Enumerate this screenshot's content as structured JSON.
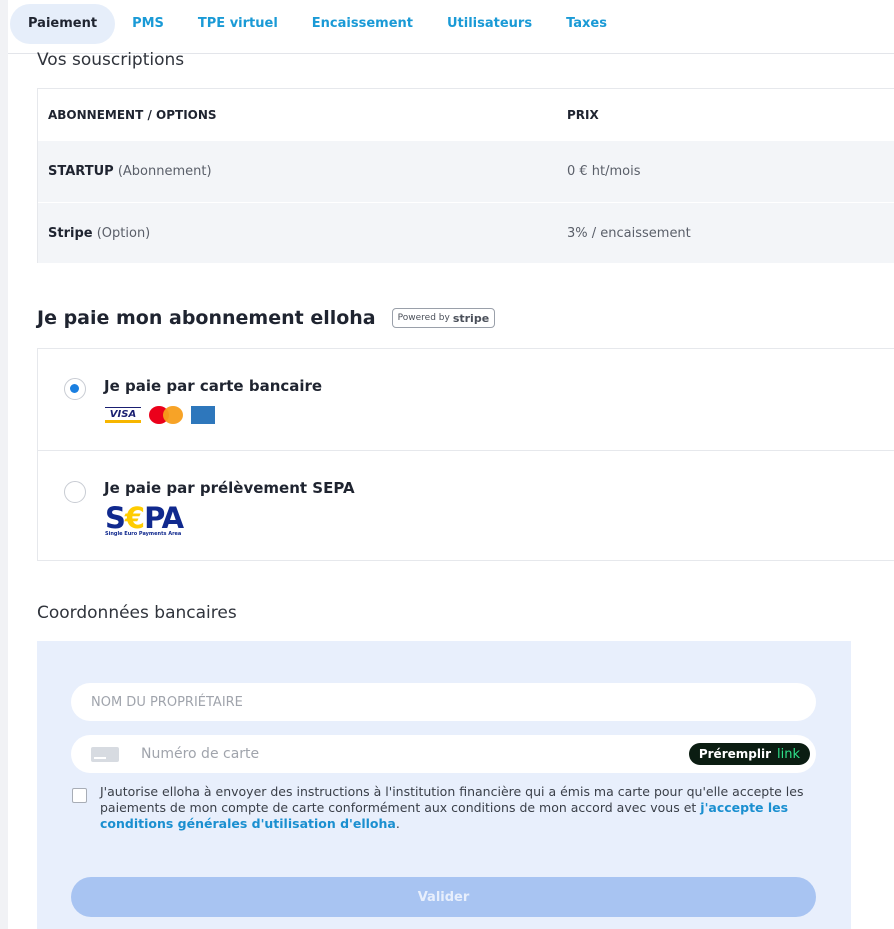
{
  "tabs": [
    {
      "label": "Paiement",
      "active": true
    },
    {
      "label": "PMS"
    },
    {
      "label": "TPE virtuel"
    },
    {
      "label": "Encaissement"
    },
    {
      "label": "Utilisateurs"
    },
    {
      "label": "Taxes"
    }
  ],
  "subscriptions": {
    "title": "Vos souscriptions",
    "headers": [
      "ABONNEMENT / OPTIONS",
      "PRIX"
    ],
    "rows": [
      {
        "name": "STARTUP",
        "type": "(Abonnement)",
        "price": "0 € ht/mois"
      },
      {
        "name": "Stripe",
        "type": "(Option)",
        "price": "3% / encaissement"
      }
    ]
  },
  "payment": {
    "title": "Je paie mon abonnement elloha",
    "badge_prefix": "Powered by",
    "badge_brand": "stripe",
    "options": [
      {
        "label": "Je paie par carte bancaire",
        "checked": true,
        "logos": [
          "VISA",
          "MasterCard",
          "American Express"
        ]
      },
      {
        "label": "Je paie par prélèvement SEPA",
        "checked": false,
        "logo_text": "S€PA",
        "logo_caption": "Single Euro Payments Area"
      }
    ]
  },
  "bank": {
    "title": "Coordonnées bancaires",
    "owner_placeholder": "NOM DU PROPRIÉTAIRE",
    "card_placeholder": "Numéro de carte",
    "prefill_label": "Préremplir",
    "prefill_brand": "link",
    "consent_text": "J'autorise elloha à envoyer des instructions à l'institution financière qui a émis ma carte pour qu'elle accepte les paiements de mon compte de carte conformément aux conditions de mon accord avec vous et ",
    "consent_link": "j'accepte les conditions générales d'utilisation d'elloha",
    "consent_end": ".",
    "submit_label": "Valider"
  },
  "colors": {
    "accent": "#1a9ad6",
    "radio_checked": "#1a7fe0",
    "panel_bg": "#e8effc",
    "submit_disabled": "#a8c4f2",
    "link_bg": "#0b1d12",
    "link_green": "#2fe08a"
  }
}
